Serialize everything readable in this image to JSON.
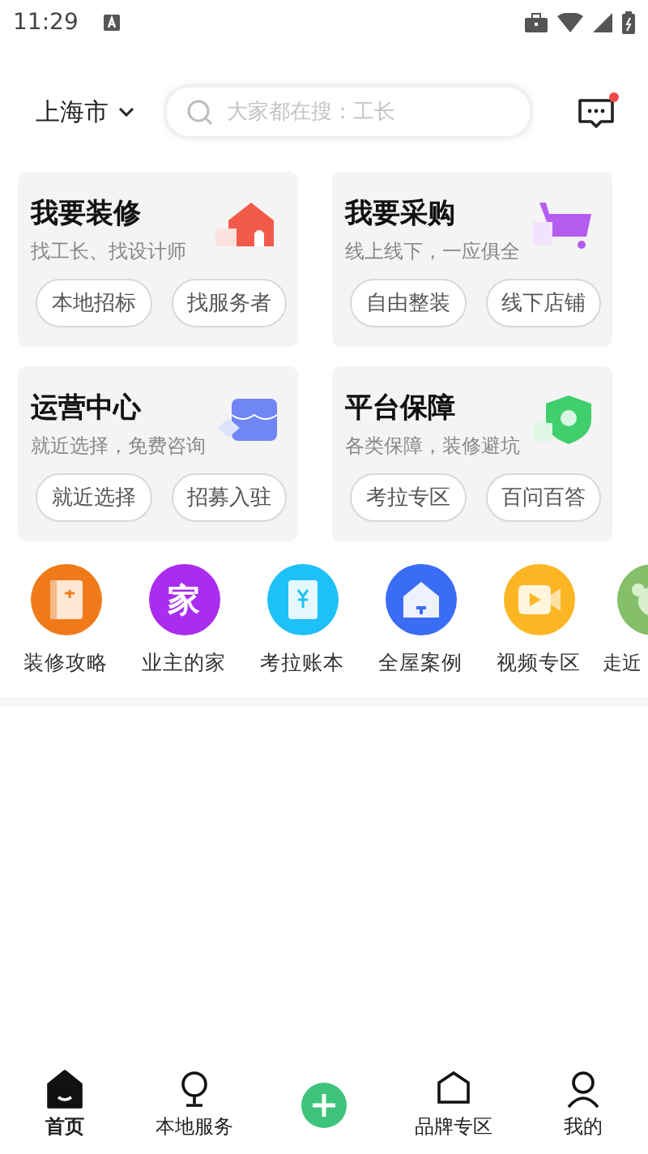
{
  "status_bar": {
    "time": "11:29"
  },
  "header": {
    "city": "上海市",
    "search": {
      "placeholder": "大家都在搜：工长"
    },
    "messages_unread": true
  },
  "cards": [
    {
      "kind": "house",
      "title": "我要装修",
      "subtitle": "找工长、找设计师",
      "links": [
        "本地招标",
        "找服务者"
      ]
    },
    {
      "kind": "cart",
      "title": "我要采购",
      "subtitle": "线上线下，一应俱全",
      "links": [
        "自由整装",
        "线下店铺"
      ]
    },
    {
      "kind": "shop",
      "title": "运营中心",
      "subtitle": "就近选择，免费咨询",
      "links": [
        "就近选择",
        "招募入驻"
      ]
    },
    {
      "kind": "shield",
      "title": "平台保障",
      "subtitle": "各类保障，装修避坑",
      "links": [
        "考拉专区",
        "百问百答"
      ]
    }
  ],
  "shortcuts": [
    {
      "kind": "book",
      "color": "#f07a1a",
      "label": "装修攻略"
    },
    {
      "kind": "glyph",
      "glyph": "家",
      "color": "#a92cf0",
      "label": "业主的家"
    },
    {
      "kind": "ledger",
      "color": "#1ec0f8",
      "label": "考拉账本"
    },
    {
      "kind": "home",
      "color": "#3a6cf6",
      "label": "全屋案例"
    },
    {
      "kind": "video",
      "color": "#fcb624",
      "label": "视频专区"
    },
    {
      "kind": "koala",
      "color": "#86bf6a",
      "label": "走近"
    }
  ],
  "tab_bar": [
    {
      "kind": "home",
      "label": "首页",
      "selected": true
    },
    {
      "kind": "pin",
      "label": "本地服务",
      "selected": false
    },
    {
      "kind": "plus"
    },
    {
      "kind": "brand",
      "label": "品牌专区",
      "selected": false
    },
    {
      "kind": "user",
      "label": "我的",
      "selected": false
    }
  ]
}
